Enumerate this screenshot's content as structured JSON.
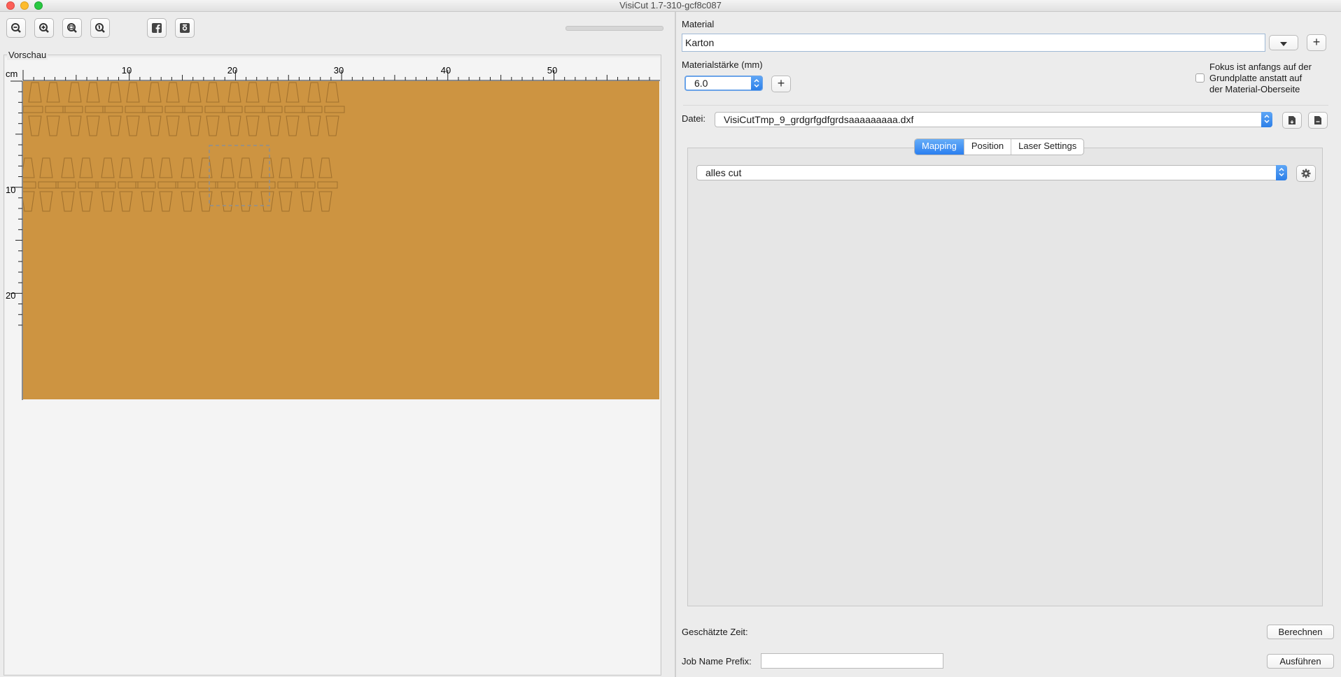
{
  "window": {
    "title": "VisiCut 1.7-310-gcf8c087"
  },
  "preview": {
    "label": "Vorschau",
    "unit": "cm",
    "x_ticks": [
      "10",
      "20",
      "30",
      "40",
      "50"
    ],
    "y_ticks": [
      "10",
      "20"
    ],
    "material_color": "#cd9441"
  },
  "toolbar": {
    "zoom_out_icon": "zoom-out-icon",
    "zoom_in_icon": "zoom-in-icon",
    "zoom_fit_icon": "zoom-fit-icon",
    "zoom_original_icon": "zoom-original-icon",
    "facebook_icon": "facebook-icon",
    "camera_icon": "camera-icon"
  },
  "material": {
    "label": "Material",
    "value": "Karton",
    "thickness_label": "Materialstärke (mm)",
    "thickness_value": "6.0",
    "focus_text_1": "Fokus ist anfangs auf der",
    "focus_text_2": "Grundplatte anstatt auf",
    "focus_text_3": "der Material-Oberseite"
  },
  "file": {
    "label": "Datei:",
    "value": "VisiCutTmp_9_grdgrfgdfgrdsaaaaaaaaa.dxf"
  },
  "tabs": [
    {
      "label": "Mapping",
      "active": true
    },
    {
      "label": "Position",
      "active": false
    },
    {
      "label": "Laser Settings",
      "active": false
    }
  ],
  "mapping": {
    "value": "alles cut"
  },
  "footer": {
    "time_label": "Geschätzte Zeit:",
    "calculate_button": "Berechnen",
    "job_prefix_label": "Job Name Prefix:",
    "job_prefix_value": "",
    "execute_button": "Ausführen"
  },
  "colors": {
    "accent": "#2c7fe8",
    "material": "#cd9441"
  }
}
